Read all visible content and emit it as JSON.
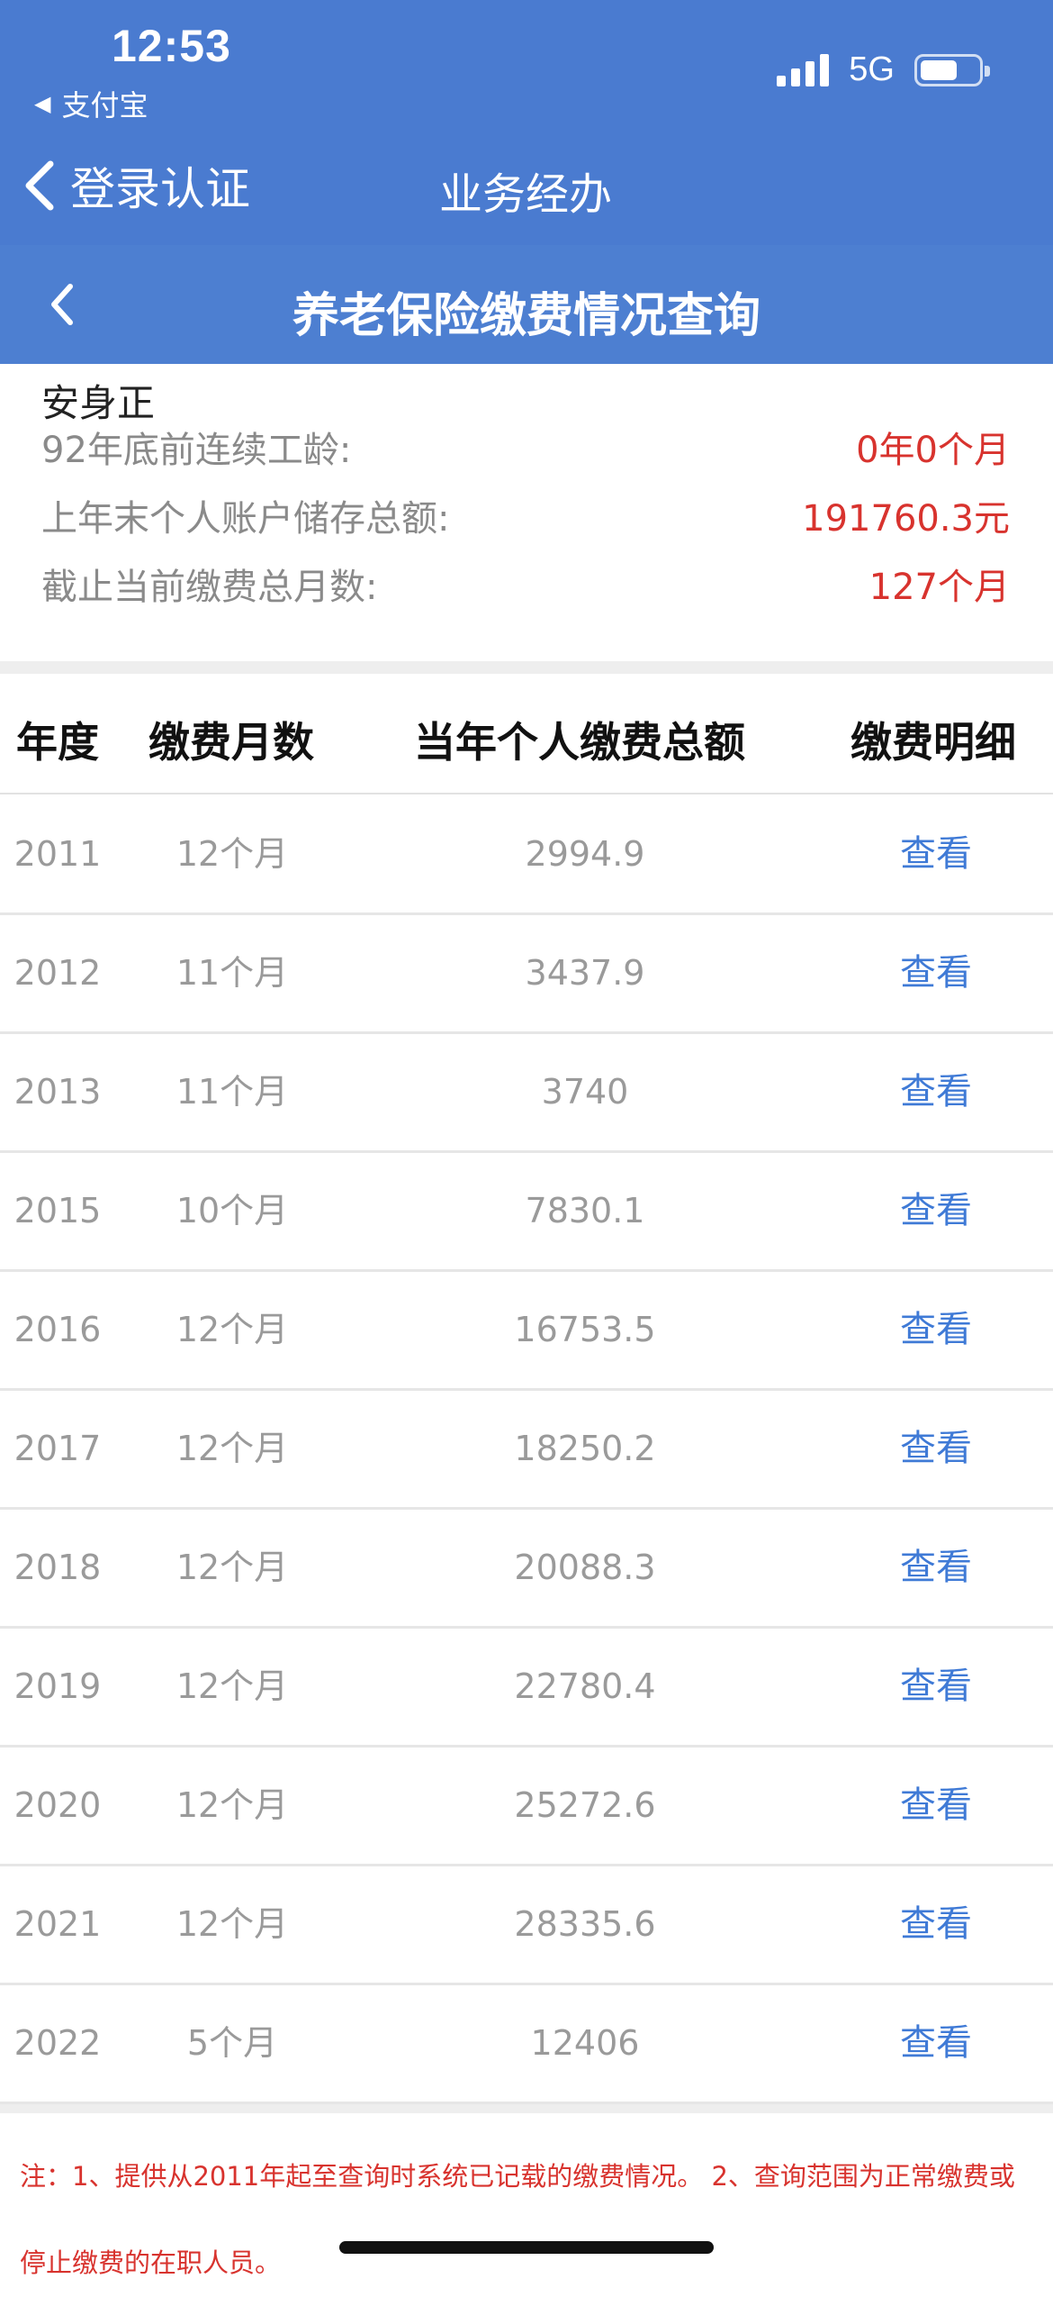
{
  "status_bar": {
    "time": "12:53",
    "back_app": "支付宝",
    "network": "5G"
  },
  "nav": {
    "back_label": "登录认证",
    "title": "业务经办"
  },
  "page": {
    "title": "养老保险缴费情况查询"
  },
  "info": {
    "name": "安身正",
    "rows": [
      {
        "label": "92年底前连续工龄:",
        "value": "0年0个月"
      },
      {
        "label": "上年末个人账户储存总额:",
        "value": "191760.3元"
      },
      {
        "label": "截止当前缴费总月数:",
        "value": "127个月"
      }
    ]
  },
  "table": {
    "headers": [
      "年度",
      "缴费月数",
      "当年个人缴费总额",
      "缴费明细"
    ],
    "rows": [
      {
        "year": "2011",
        "months": "12个月",
        "total": "2994.9",
        "action": "查看"
      },
      {
        "year": "2012",
        "months": "11个月",
        "total": "3437.9",
        "action": "查看"
      },
      {
        "year": "2013",
        "months": "11个月",
        "total": "3740",
        "action": "查看"
      },
      {
        "year": "2015",
        "months": "10个月",
        "total": "7830.1",
        "action": "查看"
      },
      {
        "year": "2016",
        "months": "12个月",
        "total": "16753.5",
        "action": "查看"
      },
      {
        "year": "2017",
        "months": "12个月",
        "total": "18250.2",
        "action": "查看"
      },
      {
        "year": "2018",
        "months": "12个月",
        "total": "20088.3",
        "action": "查看"
      },
      {
        "year": "2019",
        "months": "12个月",
        "total": "22780.4",
        "action": "查看"
      },
      {
        "year": "2020",
        "months": "12个月",
        "total": "25272.6",
        "action": "查看"
      },
      {
        "year": "2021",
        "months": "12个月",
        "total": "28335.6",
        "action": "查看"
      },
      {
        "year": "2022",
        "months": "5个月",
        "total": "12406",
        "action": "查看"
      }
    ]
  },
  "footnote": "注：1、提供从2011年起至查询时系统已记载的缴费情况。 2、查询范围为正常缴费或停止缴费的在职人员。",
  "colors": {
    "header_blue": "#4a7bd0",
    "accent_red": "#d8332e",
    "link_blue": "#3f7ad6"
  }
}
